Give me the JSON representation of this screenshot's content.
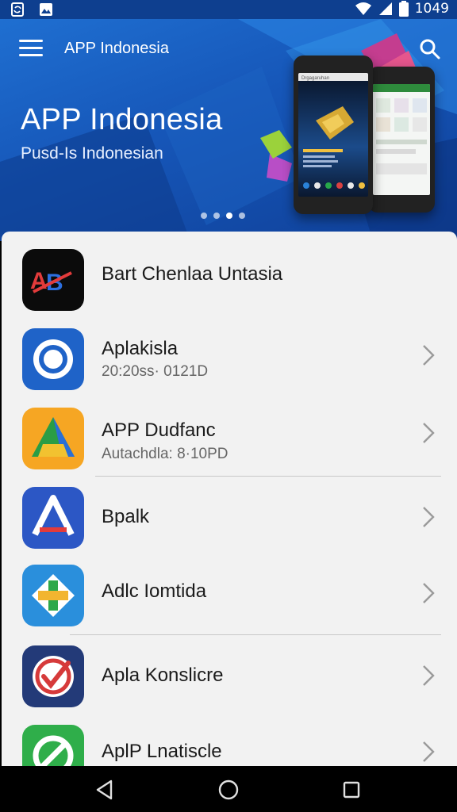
{
  "status_bar": {
    "time": "1049",
    "left_icons": [
      "screen-rotate-icon",
      "image-icon"
    ],
    "right_icons": [
      "wifi-icon",
      "signal-icon",
      "battery-icon"
    ]
  },
  "header": {
    "title": "APP Indonesia",
    "menu_icon": "hamburger-menu-icon",
    "search_icon": "search-icon"
  },
  "hero": {
    "title": "APP Indonesia",
    "subtitle": "Pusd-Is Indonesian",
    "carousel_pages": 4,
    "active_page": 3,
    "phone_screen_text": "Drgagaruhan"
  },
  "apps": [
    {
      "name": "Bart Chenlaa Untasia",
      "meta": "",
      "icon": "abc-logo-icon",
      "color": "#0b0b0b"
    },
    {
      "name": "Aplakisla",
      "meta": "20:20ss· 0121D",
      "icon": "ring-icon",
      "color": "#1f63c8"
    },
    {
      "name": "APP Dudfanc",
      "meta": "Autachdla: 8·10PD",
      "icon": "triangle-a-icon",
      "color": "#f6a623"
    },
    {
      "name": "Bpalk",
      "meta": "",
      "icon": "a-arrow-icon",
      "color": "#2c57c5"
    },
    {
      "name": "Adlc Iomtida",
      "meta": "",
      "icon": "diamond-plus-icon",
      "color": "#2a8fdc"
    },
    {
      "name": "Apla Konslicre",
      "meta": "",
      "icon": "check-target-icon",
      "color": "#233a78"
    },
    {
      "name": "AplP Lnatiscle",
      "meta": "",
      "icon": "circle-slash-icon",
      "color": "#2fae4a"
    }
  ],
  "nav_bar": {
    "back_icon": "back-triangle-icon",
    "home_icon": "home-circle-icon",
    "recents_icon": "recents-square-icon"
  }
}
